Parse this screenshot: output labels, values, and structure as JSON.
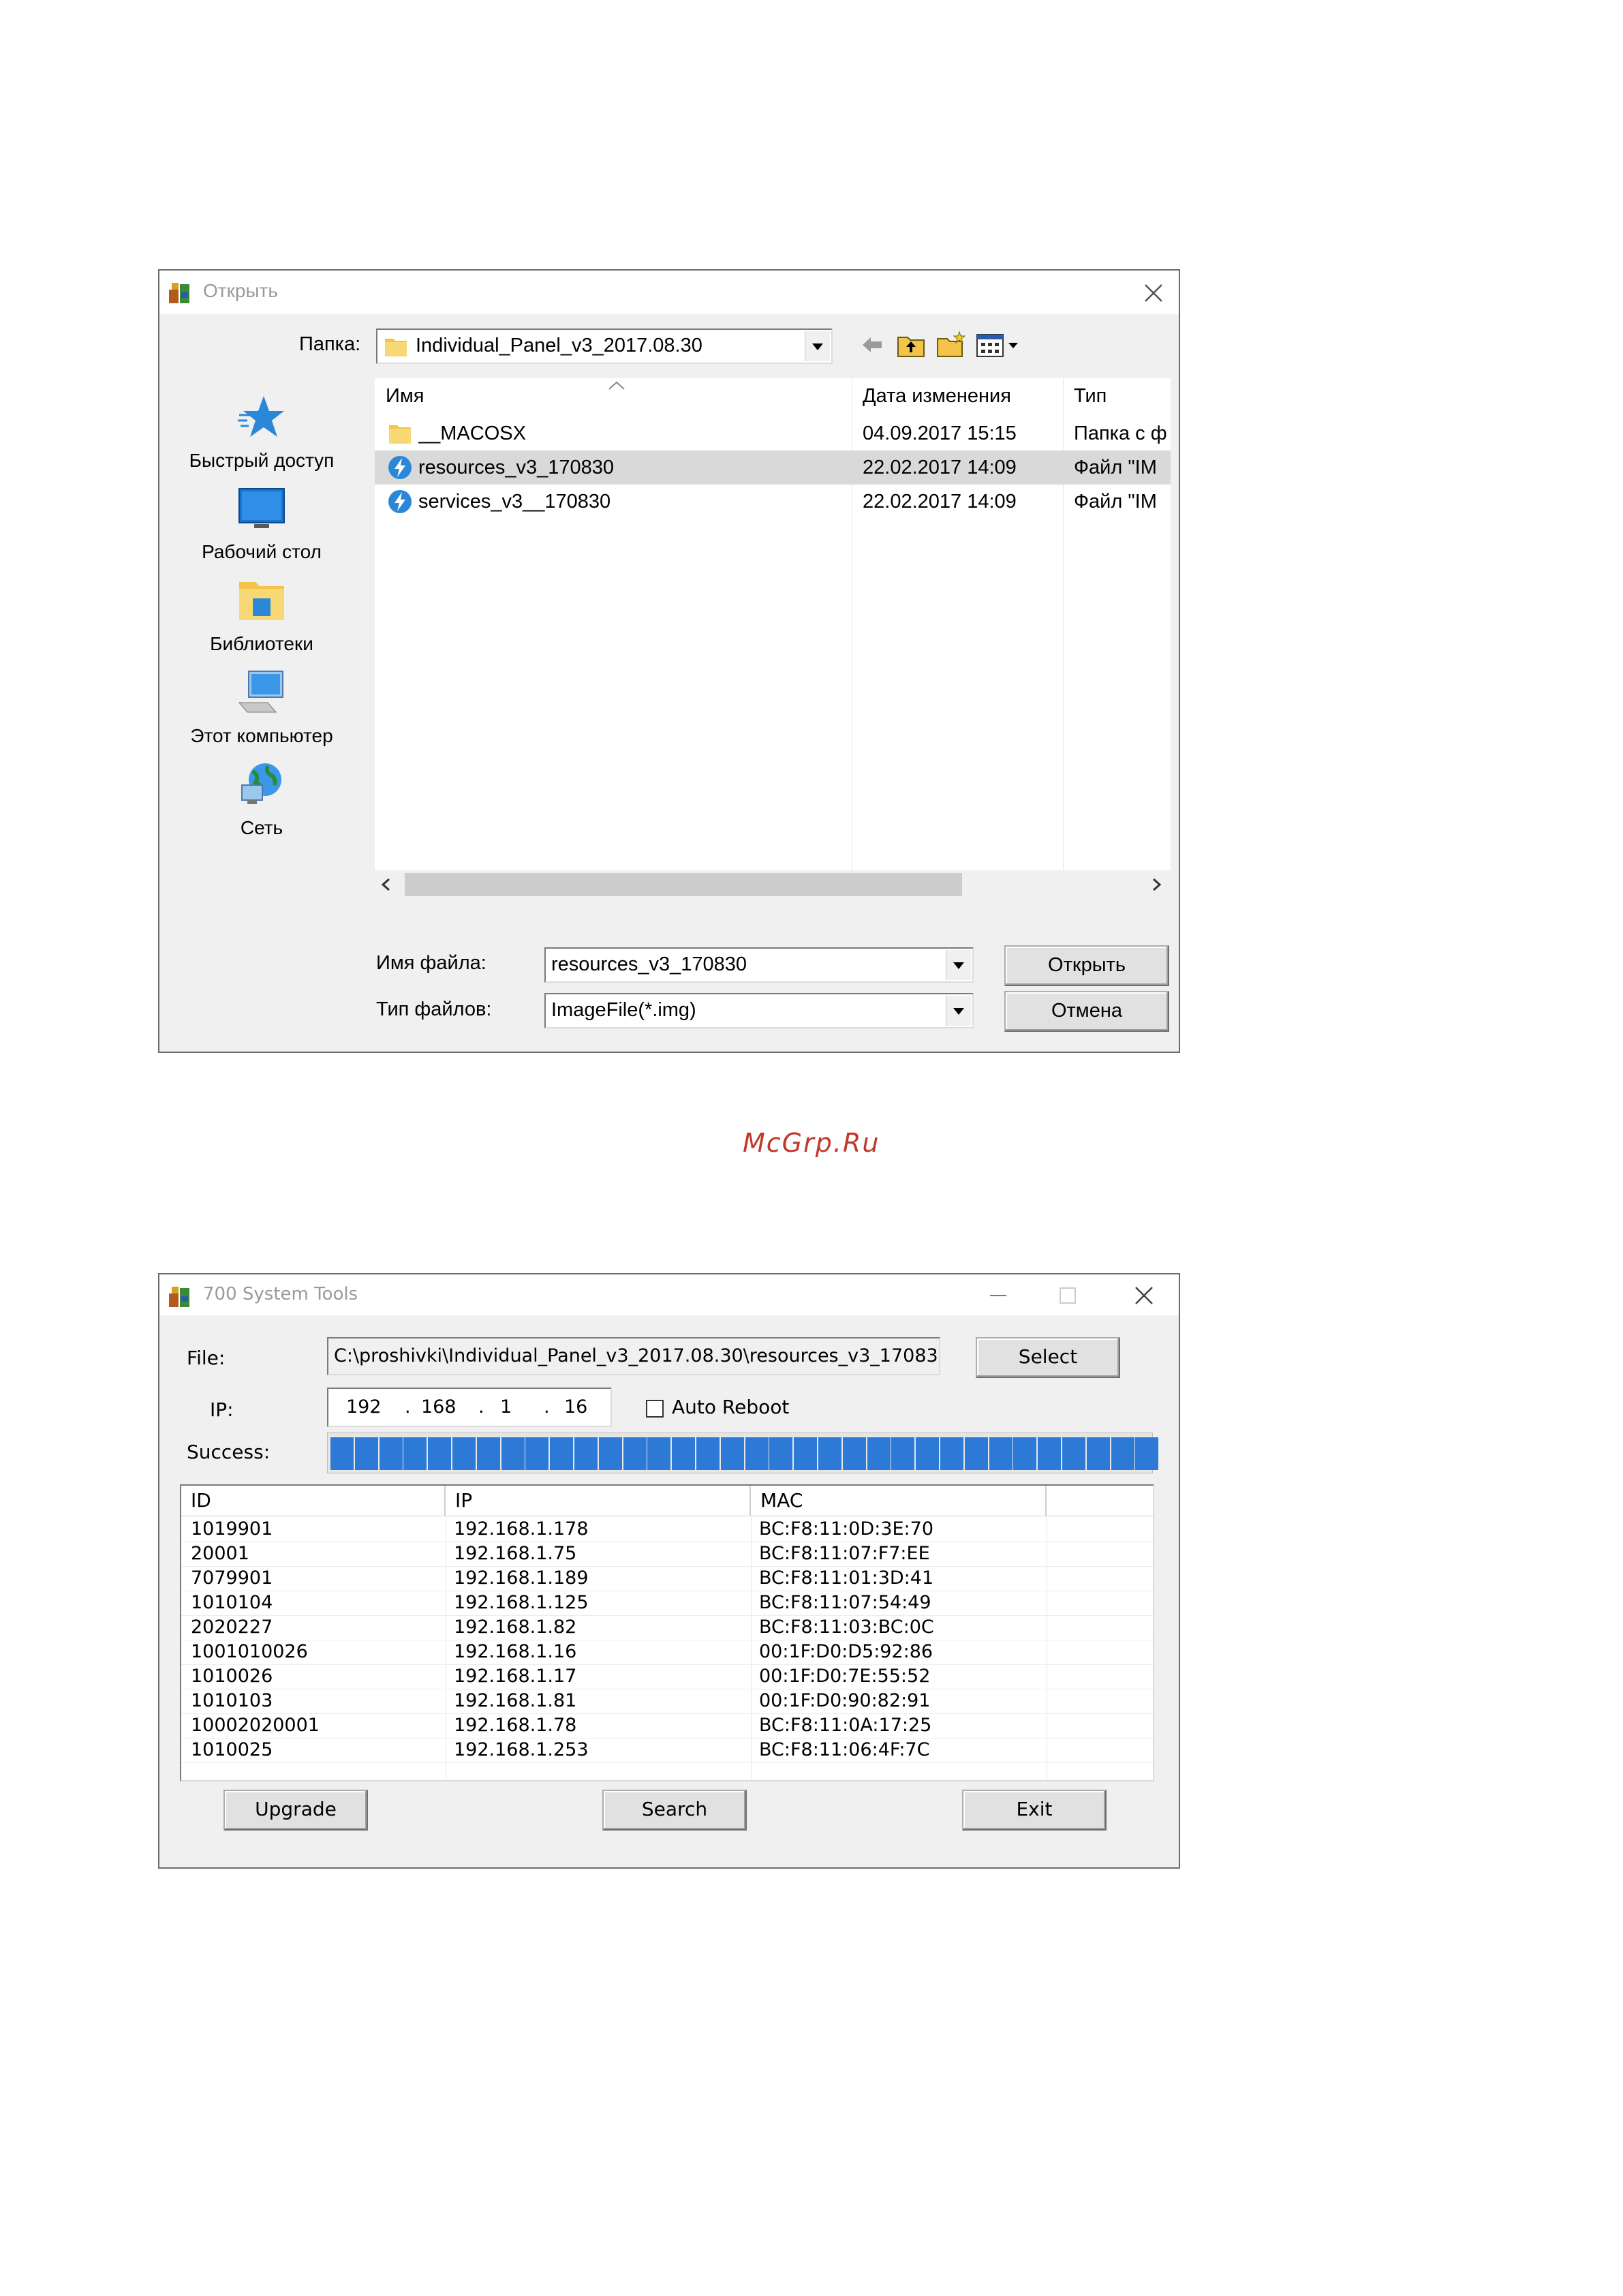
{
  "open_dialog": {
    "title": "Открыть",
    "folder_label": "Папка:",
    "folder_value": "Individual_Panel_v3_2017.08.30",
    "places": [
      {
        "label": "Быстрый доступ",
        "icon": "star-icon"
      },
      {
        "label": "Рабочий стол",
        "icon": "desktop-icon"
      },
      {
        "label": "Библиотеки",
        "icon": "libraries-icon"
      },
      {
        "label": "Этот компьютер",
        "icon": "computer-icon"
      },
      {
        "label": "Сеть",
        "icon": "network-icon"
      }
    ],
    "columns": [
      "Имя",
      "Дата изменения",
      "Тип"
    ],
    "files": [
      {
        "name": "__MACOSX",
        "date": "04.09.2017 15:15",
        "type": "Папка с ф",
        "icon": "folder-icon"
      },
      {
        "name": "resources_v3_170830",
        "date": "22.02.2017 14:09",
        "type": "Файл \"IM",
        "icon": "image-file-icon"
      },
      {
        "name": "services_v3__170830",
        "date": "22.02.2017 14:09",
        "type": "Файл \"IM",
        "icon": "image-file-icon"
      }
    ],
    "filename_label": "Имя файла:",
    "filename_value": "resources_v3_170830",
    "filetype_label": "Тип файлов:",
    "filetype_value": "ImageFile(*.img)",
    "open_button": "Открыть",
    "cancel_button": "Отмена"
  },
  "watermark": "McGrp.Ru",
  "tool": {
    "title": "700 System Tools",
    "file_label": "File:",
    "file_value": "C:\\proshivki\\Individual_Panel_v3_2017.08.30\\resources_v3_17083(",
    "select_button": "Select",
    "ip_label": "IP:",
    "ip_octets": [
      "192",
      "168",
      "1",
      "16"
    ],
    "auto_reboot_label": "Auto Reboot",
    "success_label": "Success:",
    "progress_fraction": 1.0,
    "columns": [
      "ID",
      "IP",
      "MAC"
    ],
    "rows": [
      {
        "id": "1019901",
        "ip": "192.168.1.178",
        "mac": "BC:F8:11:0D:3E:70"
      },
      {
        "id": "20001",
        "ip": "192.168.1.75",
        "mac": "BC:F8:11:07:F7:EE"
      },
      {
        "id": "7079901",
        "ip": "192.168.1.189",
        "mac": "BC:F8:11:01:3D:41"
      },
      {
        "id": "1010104",
        "ip": "192.168.1.125",
        "mac": "BC:F8:11:07:54:49"
      },
      {
        "id": "2020227",
        "ip": "192.168.1.82",
        "mac": "BC:F8:11:03:BC:0C"
      },
      {
        "id": "1001010026",
        "ip": "192.168.1.16",
        "mac": "00:1F:D0:D5:92:86"
      },
      {
        "id": "1010026",
        "ip": "192.168.1.17",
        "mac": "00:1F:D0:7E:55:52"
      },
      {
        "id": "1010103",
        "ip": "192.168.1.81",
        "mac": "00:1F:D0:90:82:91"
      },
      {
        "id": "10002020001",
        "ip": "192.168.1.78",
        "mac": "BC:F8:11:0A:17:25"
      },
      {
        "id": "1010025",
        "ip": "192.168.1.253",
        "mac": "BC:F8:11:06:4F:7C"
      }
    ],
    "upgrade_button": "Upgrade",
    "search_button": "Search",
    "exit_button": "Exit"
  },
  "colors": {
    "accent": "#2c7ad6",
    "selection": "#d9d9d9",
    "watermark": "#c0392b"
  }
}
